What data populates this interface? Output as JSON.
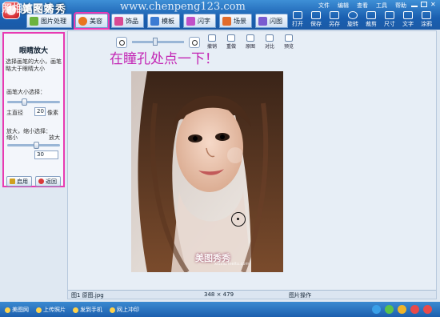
{
  "title_overlay": "美图秀秀",
  "site_watermark_left": "照相馆网站",
  "site_watermark": "www.chenpeng123.com",
  "menu": [
    "文件",
    "编辑",
    "查看",
    "工具",
    "帮助"
  ],
  "tabs": [
    {
      "label": "图片处理",
      "color": "#6cb33e"
    },
    {
      "label": "美容",
      "color": "#e8761e"
    },
    {
      "label": "饰品",
      "color": "#d84a94"
    },
    {
      "label": "模板",
      "color": "#3b7bd3"
    },
    {
      "label": "闪字",
      "color": "#c04fc8"
    },
    {
      "label": "场景",
      "color": "#e26b2b"
    },
    {
      "label": "闪图",
      "color": "#7a5bd0"
    }
  ],
  "active_tab": "美容",
  "toolbar": [
    "打开",
    "保存",
    "另存",
    "旋转",
    "裁剪",
    "尺寸",
    "文字",
    "涂鸦"
  ],
  "panel": {
    "title": "眼睛放大",
    "description": "选择画笔的大小，画笔略大于眼睛大小",
    "brush_label": "画笔大小选择：",
    "brush_sub": "主直径",
    "brush_value": "20",
    "brush_unit": "像素",
    "scale_label": "放大，缩小选择：",
    "scale_min": "缩小",
    "scale_max": "放大",
    "scale_value": "30",
    "apply_button": "启用",
    "back_button": "返回"
  },
  "canvas_controls": [
    "撤销",
    "重做",
    "原图",
    "对比",
    "预览"
  ],
  "hint_text": "在瞳孔处点一下！",
  "photo_watermark": "美图秀秀",
  "photo_watermark_sub": "xiuxiu.meitu.com",
  "status": {
    "left": "图1 原图.jpg",
    "size": "348 × 479",
    "right": "图片操作"
  },
  "bottom_links": [
    "美图网",
    "上传照片",
    "发到手机",
    "网上冲印"
  ],
  "bottom_icon_colors": [
    "#3aa0e8",
    "#5bc24a",
    "#f0b429",
    "#e84a4a",
    "#e84a4a"
  ]
}
